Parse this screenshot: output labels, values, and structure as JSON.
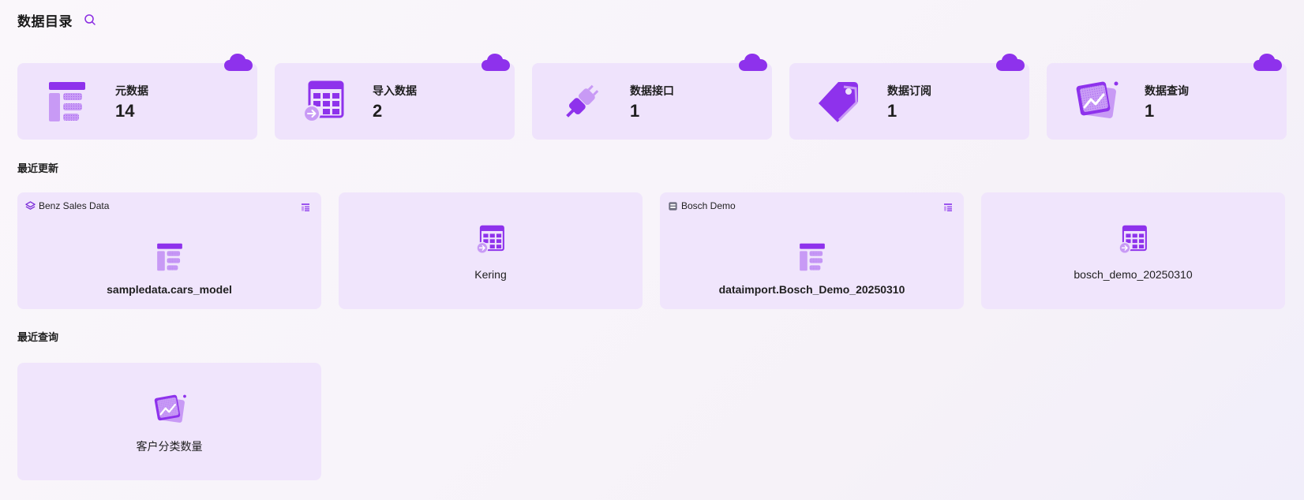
{
  "header": {
    "title": "数据目录",
    "search_icon": "search-icon"
  },
  "colors": {
    "accent": "#8a2be2",
    "accent_light": "#c89af5",
    "card_bg": "#efe3fc"
  },
  "stats": [
    {
      "label": "元数据",
      "value": "14",
      "icon": "metadata-icon"
    },
    {
      "label": "导入数据",
      "value": "2",
      "icon": "import-table-icon"
    },
    {
      "label": "数据接口",
      "value": "1",
      "icon": "plug-icon"
    },
    {
      "label": "数据订阅",
      "value": "1",
      "icon": "tag-icon"
    },
    {
      "label": "数据查询",
      "value": "1",
      "icon": "chart-query-icon"
    }
  ],
  "recent_updates": {
    "title": "最近更新",
    "items": [
      {
        "tag": "Benz Sales Data",
        "name": "sampledata.cars_model",
        "icon": "metadata-icon"
      },
      {
        "tag": "",
        "name": "Kering",
        "icon": "import-table-icon"
      },
      {
        "tag": "Bosch Demo",
        "name": "dataimport.Bosch_Demo_20250310",
        "icon": "metadata-icon"
      },
      {
        "tag": "",
        "name": "bosch_demo_20250310",
        "icon": "import-table-icon"
      }
    ]
  },
  "recent_queries": {
    "title": "最近查询",
    "items": [
      {
        "name": "客户分类数量",
        "icon": "chart-query-icon"
      }
    ]
  }
}
